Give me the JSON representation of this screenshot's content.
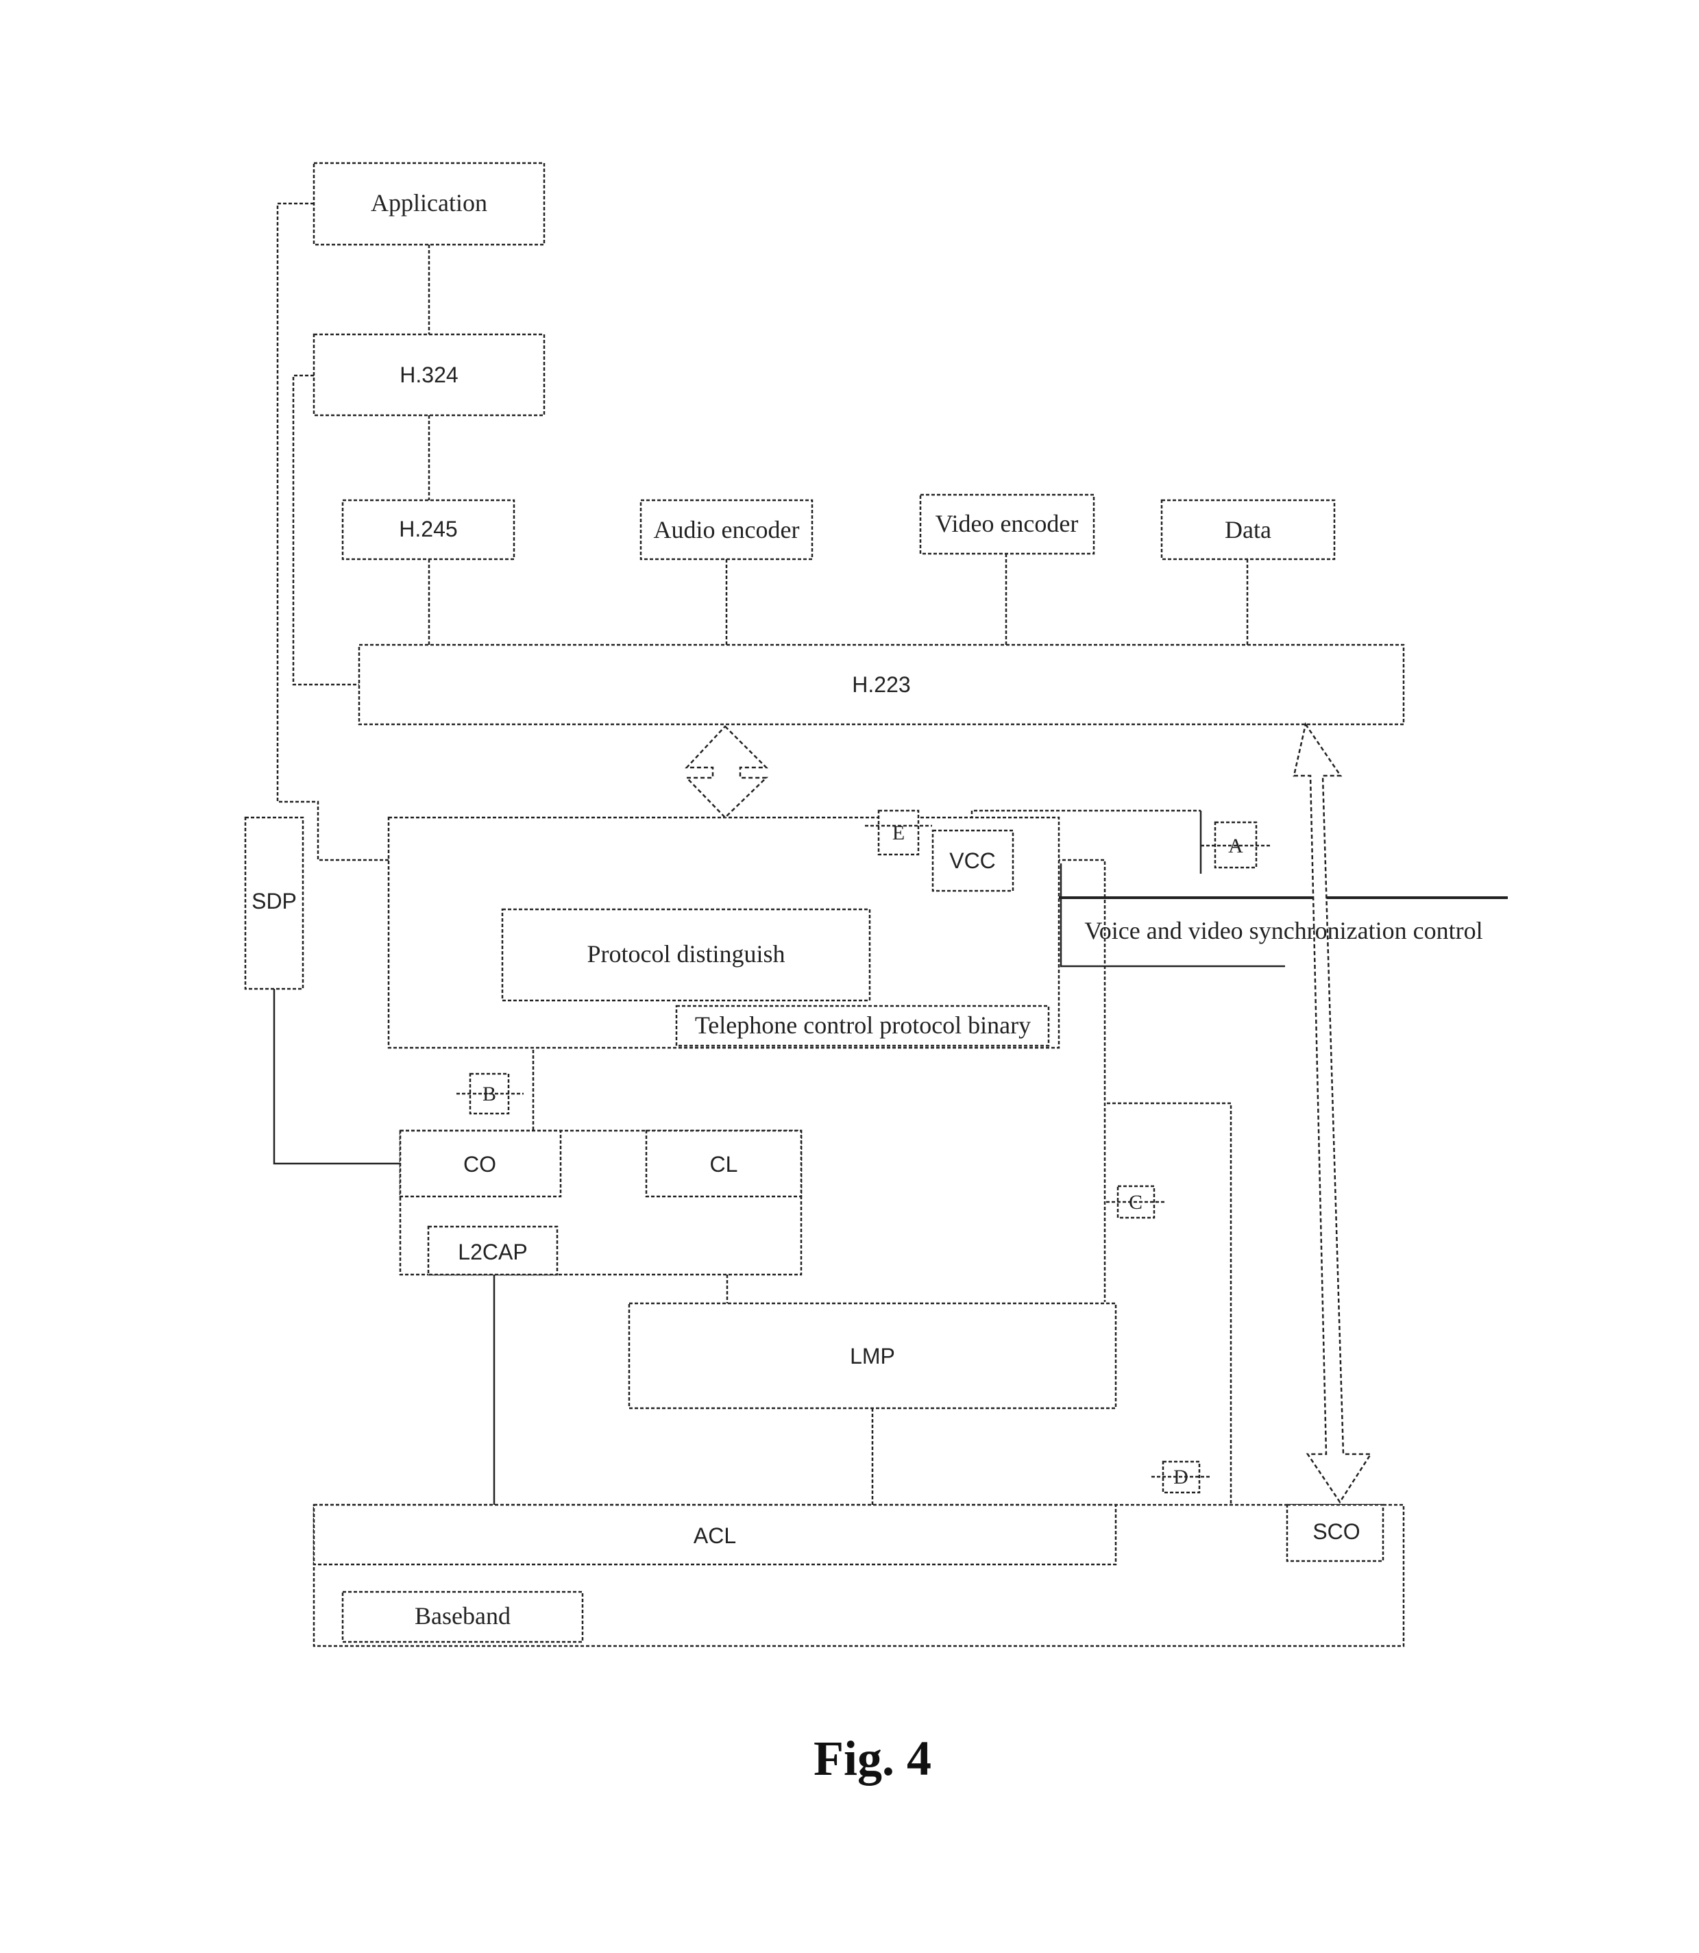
{
  "figure": {
    "caption": "Fig. 4",
    "blocks": {
      "application": "Application",
      "h324": "H.324",
      "h245": "H.245",
      "audio_encoder": "Audio encoder",
      "video_encoder": "Video encoder",
      "data": "Data",
      "h223": "H.223",
      "sdp": "SDP",
      "vcc": "VCC",
      "protocol_distinguish": "Protocol distinguish",
      "tcs_binary": "Telephone control protocol binary",
      "voice_video_sync": "Voice and video synchronization control",
      "co": "CO",
      "cl": "CL",
      "l2cap": "L2CAP",
      "lmp": "LMP",
      "acl": "ACL",
      "sco": "SCO",
      "baseband": "Baseband"
    },
    "markers": {
      "a": "A",
      "b": "B",
      "c": "C",
      "d": "D",
      "e": "E"
    }
  }
}
